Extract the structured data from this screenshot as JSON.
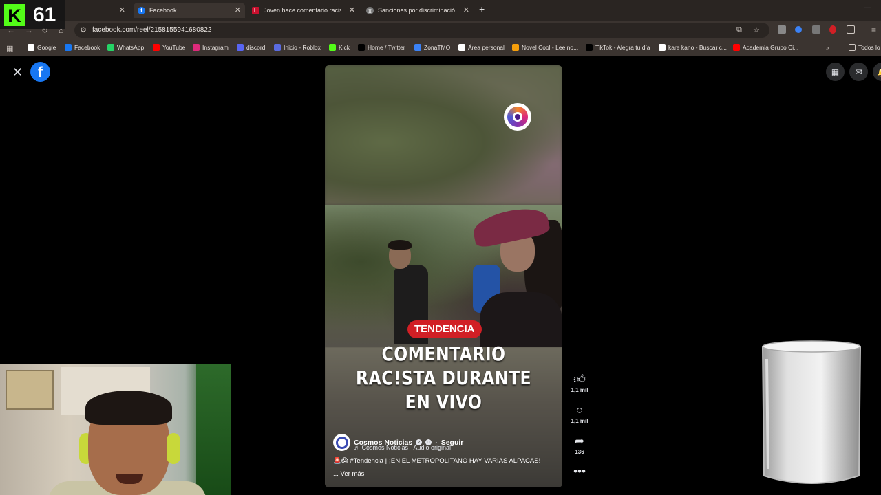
{
  "browser": {
    "tabs": [
      {
        "label": "",
        "active": false
      },
      {
        "label": "Facebook",
        "active": true
      },
      {
        "label": "Joven hace comentario racista",
        "active": false
      },
      {
        "label": "Sanciones por discriminación P",
        "active": false
      }
    ],
    "url": "facebook.com/reel/2158155941680822",
    "bookmarks": [
      {
        "label": "Google",
        "icon": "google-icon",
        "color": "#ffffff"
      },
      {
        "label": "Facebook",
        "icon": "facebook-icon",
        "color": "#1877f2"
      },
      {
        "label": "WhatsApp",
        "icon": "whatsapp-icon",
        "color": "#25d366"
      },
      {
        "label": "YouTube",
        "icon": "youtube-icon",
        "color": "#ff0000"
      },
      {
        "label": "Instagram",
        "icon": "instagram-icon",
        "color": "#dd2a7b"
      },
      {
        "label": "discord",
        "icon": "discord-icon",
        "color": "#5865f2"
      },
      {
        "label": "Inicio - Roblox",
        "icon": "roblox-icon",
        "color": "#5a6be0"
      },
      {
        "label": "Kick",
        "icon": "kick-icon",
        "color": "#53fc18"
      },
      {
        "label": "Home / Twitter",
        "icon": "x-icon",
        "color": "#000000"
      },
      {
        "label": "ZonaTMO",
        "icon": "zonatmo-icon",
        "color": "#3b82f6"
      },
      {
        "label": "Área personal",
        "icon": "area-icon",
        "color": "#ffffff"
      },
      {
        "label": "Novel Cool - Lee no...",
        "icon": "novelcool-icon",
        "color": "#f59e0b"
      },
      {
        "label": "TikTok - Alegra tu día",
        "icon": "tiktok-icon",
        "color": "#000000"
      },
      {
        "label": "kare kano - Buscar c...",
        "icon": "google-icon",
        "color": "#ffffff"
      },
      {
        "label": "Academia Grupo Ci...",
        "icon": "youtube-icon",
        "color": "#ff0000"
      }
    ],
    "all_bookmarks_label": "Todos lo"
  },
  "overlay": {
    "kick_letter": "K",
    "viewer_count": "61"
  },
  "reel": {
    "tag": "TENDENCIA",
    "headline_lines": [
      "COMENTARIO",
      "RAC!STA DURANTE",
      "EN VIVO"
    ],
    "author": "Cosmos Noticias",
    "follow": "Seguir",
    "subline": "♬ Cosmos Noticias · Audio original",
    "description": "🚨😱 #Tendencia | ¡EN EL METROPOLITANO HAY VARIAS ALPACAS!",
    "see_more": "... Ver más",
    "likes": "1,1 mil",
    "comments": "1,1 mil",
    "shares": "136"
  },
  "colors": {
    "facebook_blue": "#1877f2",
    "tag_red": "#d11f25",
    "kick_green": "#53fc18"
  }
}
